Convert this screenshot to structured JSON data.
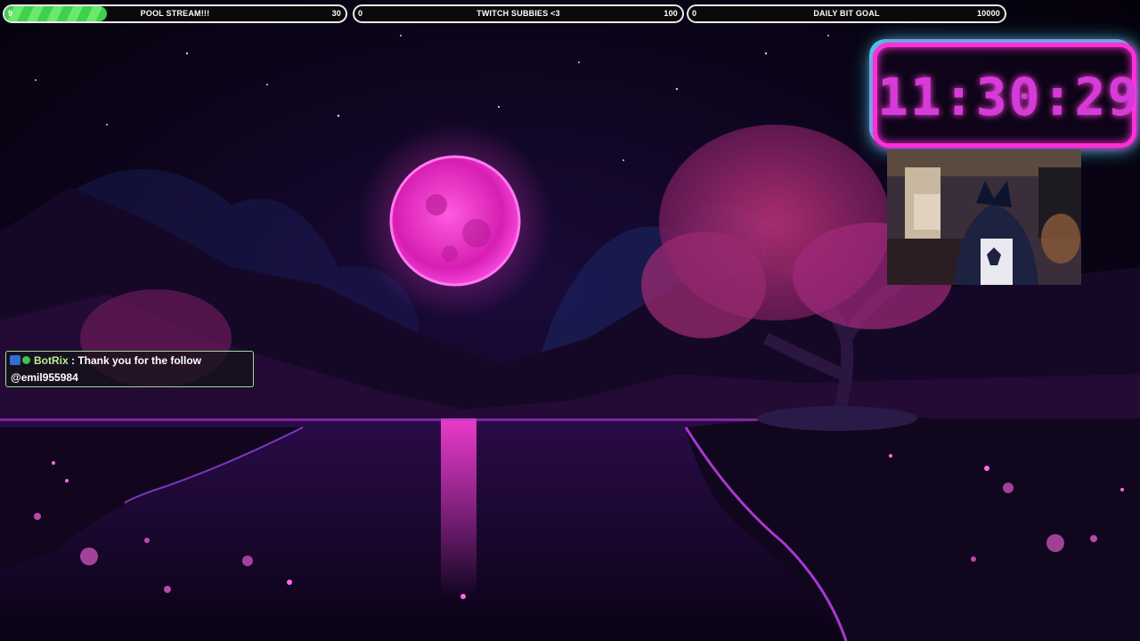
{
  "goals": [
    {
      "label": "POOL STREAM!!!",
      "current": "9",
      "target": "30",
      "progress": 0.3
    },
    {
      "label": "TWITCH SUBBIES <3",
      "current": "0",
      "target": "100",
      "progress": 0
    },
    {
      "label": "DAILY BIT GOAL",
      "current": "0",
      "target": "10000",
      "progress": 0
    }
  ],
  "clock": {
    "time": "11:30:29"
  },
  "chat": {
    "username": "BotRix",
    "message": " : Thank you for the follow",
    "mention": "@emil955984"
  },
  "colors": {
    "clock_pink": "#ff2fd8",
    "clock_cyan": "#27e3e8",
    "moon": "#ff3bd0",
    "progress_green": "#3fd14a"
  }
}
